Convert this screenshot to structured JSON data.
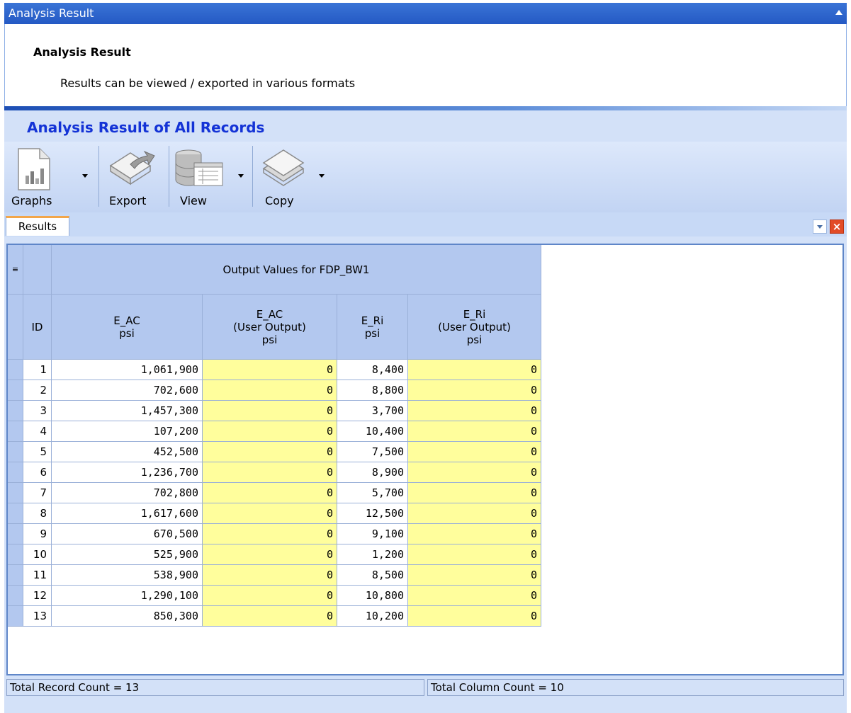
{
  "window": {
    "title": "Analysis Result"
  },
  "header": {
    "heading": "Analysis Result",
    "subtitle": "Results can be viewed / exported in various formats"
  },
  "panel": {
    "title": "Analysis Result of All Records"
  },
  "toolbar": {
    "graphs_label": "Graphs",
    "export_label": "Export",
    "view_label": "View",
    "copy_label": "Copy"
  },
  "tabs": [
    {
      "label": "Results",
      "active": true
    }
  ],
  "grid": {
    "group_header": "Output Values for FDP_BW1",
    "columns": [
      {
        "key": "id",
        "label": "ID"
      },
      {
        "key": "e_ac",
        "label": "E_AC\npsi"
      },
      {
        "key": "e_ac_user",
        "label": "E_AC\n(User Output)\npsi"
      },
      {
        "key": "e_ri",
        "label": "E_Ri\npsi"
      },
      {
        "key": "e_ri_user",
        "label": "E_Ri\n(User Output)\npsi"
      }
    ],
    "rows": [
      {
        "id": "1",
        "e_ac": "1,061,900",
        "e_ac_user": "0",
        "e_ri": "8,400",
        "e_ri_user": "0"
      },
      {
        "id": "2",
        "e_ac": "702,600",
        "e_ac_user": "0",
        "e_ri": "8,800",
        "e_ri_user": "0"
      },
      {
        "id": "3",
        "e_ac": "1,457,300",
        "e_ac_user": "0",
        "e_ri": "3,700",
        "e_ri_user": "0"
      },
      {
        "id": "4",
        "e_ac": "107,200",
        "e_ac_user": "0",
        "e_ri": "10,400",
        "e_ri_user": "0"
      },
      {
        "id": "5",
        "e_ac": "452,500",
        "e_ac_user": "0",
        "e_ri": "7,500",
        "e_ri_user": "0"
      },
      {
        "id": "6",
        "e_ac": "1,236,700",
        "e_ac_user": "0",
        "e_ri": "8,900",
        "e_ri_user": "0"
      },
      {
        "id": "7",
        "e_ac": "702,800",
        "e_ac_user": "0",
        "e_ri": "5,700",
        "e_ri_user": "0"
      },
      {
        "id": "8",
        "e_ac": "1,617,600",
        "e_ac_user": "0",
        "e_ri": "12,500",
        "e_ri_user": "0"
      },
      {
        "id": "9",
        "e_ac": "670,500",
        "e_ac_user": "0",
        "e_ri": "9,100",
        "e_ri_user": "0"
      },
      {
        "id": "10",
        "e_ac": "525,900",
        "e_ac_user": "0",
        "e_ri": "1,200",
        "e_ri_user": "0"
      },
      {
        "id": "11",
        "e_ac": "538,900",
        "e_ac_user": "0",
        "e_ri": "8,500",
        "e_ri_user": "0"
      },
      {
        "id": "12",
        "e_ac": "1,290,100",
        "e_ac_user": "0",
        "e_ri": "10,800",
        "e_ri_user": "0"
      },
      {
        "id": "13",
        "e_ac": "850,300",
        "e_ac_user": "0",
        "e_ri": "10,200",
        "e_ri_user": "0"
      }
    ]
  },
  "status": {
    "record_count": "Total Record Count = 13",
    "column_count": "Total Column Count = 10"
  },
  "colors": {
    "titlebar": "#2459c4",
    "panel_title": "#1433d6",
    "user_output_cell": "#fffe9c",
    "header_cell": "#b3c8ef"
  },
  "icons": {
    "graphs": "graph-document-icon",
    "export": "export-arrow-icon",
    "view": "database-view-icon",
    "copy": "copy-pages-icon"
  }
}
